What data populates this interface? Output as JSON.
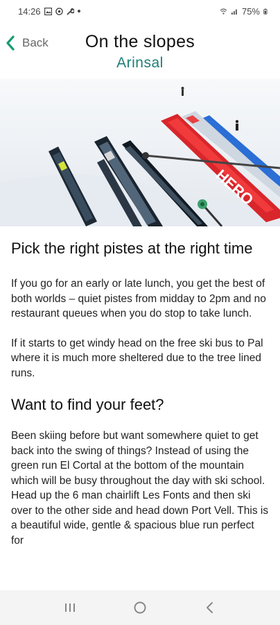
{
  "status_bar": {
    "time": "14:26",
    "battery": "75%",
    "icons": [
      "image-icon",
      "circle-check-icon",
      "wrench-icon",
      "dot-icon",
      "wifi-calling-icon",
      "signal-icon",
      "battery-icon"
    ]
  },
  "header": {
    "back_label": "Back",
    "title": "On the slopes",
    "subtitle": "Arinsal"
  },
  "hero_image": {
    "description_icon": "skis-in-snow-photo"
  },
  "article": {
    "heading_1": "Pick the right pistes at the right time",
    "paragraph_1": "If you go for an early or late lunch, you get the best of both worlds – quiet pistes from midday to 2pm and no restaurant queues when you do stop to take lunch.",
    "paragraph_2": "If it starts to get windy head on the free ski bus to Pal where it is much more sheltered due to the tree lined runs.",
    "heading_2": "Want to find your feet?",
    "paragraph_3": "Been skiing before but want somewhere quiet to get back into the swing of things? Instead of using the green run El Cortal at the bottom of the mountain which will be busy throughout the day with ski school. Head up the 6 man chairlift Les Fonts and then ski over to the other side and head down Port Vell. This is a beautiful wide, gentle & spacious blue run perfect for"
  },
  "nav_bar": {
    "buttons": [
      "recent-apps-icon",
      "home-icon",
      "back-nav-icon"
    ]
  },
  "colors": {
    "accent": "#1f7f78",
    "back_chevron": "#1a9b74",
    "nav_background": "#f4f4f4"
  }
}
